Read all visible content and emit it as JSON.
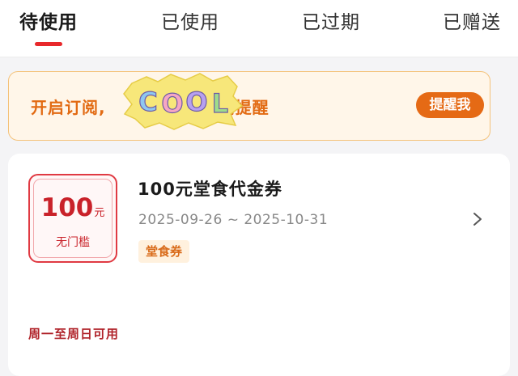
{
  "tabs": [
    {
      "label": "待使用",
      "active": true
    },
    {
      "label": "已使用",
      "active": false
    },
    {
      "label": "已过期",
      "active": false
    },
    {
      "label": "已赠送",
      "active": false
    }
  ],
  "banner": {
    "text_before": "开启订阅,",
    "text_after": "到期提醒",
    "button_label": "提醒我",
    "sticker_text": "COOL"
  },
  "coupon": {
    "amount": "100",
    "unit": "元",
    "threshold": "无门槛",
    "title": "100元堂食代金券",
    "dates": "2025-09-26 ~ 2025-10-31",
    "tag": "堂食券",
    "usage": "周一至周日可用"
  },
  "colors": {
    "accent_red": "#e8282b",
    "banner_orange": "#e26a12",
    "button_orange": "#e56a15",
    "coupon_red": "#c9222a"
  },
  "icons": {
    "chevron": "chevron-right-icon"
  }
}
